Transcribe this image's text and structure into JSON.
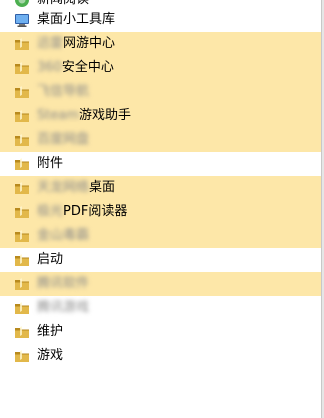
{
  "menu": {
    "partial_top": {
      "label": "新闻阅读"
    },
    "items": [
      {
        "key": "desktop-tools",
        "label": "桌面小工具库",
        "blur": "",
        "icon": "window-icon",
        "highlight": false
      },
      {
        "key": "game-center",
        "label": "网游中心",
        "blur": "迅雷",
        "icon": "folder-icon",
        "highlight": true
      },
      {
        "key": "security-center",
        "label": "安全中心",
        "blur": "360",
        "icon": "folder-icon",
        "highlight": true
      },
      {
        "key": "blurred-1",
        "label": "",
        "blur": "飞信导航",
        "icon": "folder-icon",
        "highlight": true
      },
      {
        "key": "game-assistant",
        "label": "游戏助手",
        "blur": "Steam",
        "icon": "folder-icon",
        "highlight": true
      },
      {
        "key": "blurred-2",
        "label": "",
        "blur": "百度网盘",
        "icon": "folder-icon",
        "highlight": true
      },
      {
        "key": "accessories",
        "label": "附件",
        "blur": "",
        "icon": "folder-icon",
        "highlight": false
      },
      {
        "key": "desktop",
        "label": "桌面",
        "blur": "天龙网络",
        "icon": "folder-icon",
        "highlight": true
      },
      {
        "key": "pdf-reader",
        "label": "PDF阅读器",
        "blur": "极光",
        "icon": "folder-icon",
        "highlight": true
      },
      {
        "key": "blurred-3",
        "label": "",
        "blur": "金山毒霸",
        "icon": "folder-icon",
        "highlight": true
      },
      {
        "key": "startup",
        "label": "启动",
        "blur": "",
        "icon": "folder-icon",
        "highlight": false
      },
      {
        "key": "blurred-4",
        "label": "",
        "blur": "腾讯软件",
        "icon": "folder-icon",
        "highlight": true
      },
      {
        "key": "blurred-5",
        "label": "",
        "blur": "腾讯游戏",
        "icon": "folder-icon",
        "highlight": false
      },
      {
        "key": "maintenance",
        "label": "维护",
        "blur": "",
        "icon": "folder-icon",
        "highlight": false
      },
      {
        "key": "games",
        "label": "游戏",
        "blur": "",
        "icon": "folder-icon",
        "highlight": false
      }
    ]
  },
  "colors": {
    "highlight": "#fde7a8",
    "folder": "#e2b84a",
    "folder_dark": "#b88a1e",
    "window_blue": "#3a7bd5"
  }
}
